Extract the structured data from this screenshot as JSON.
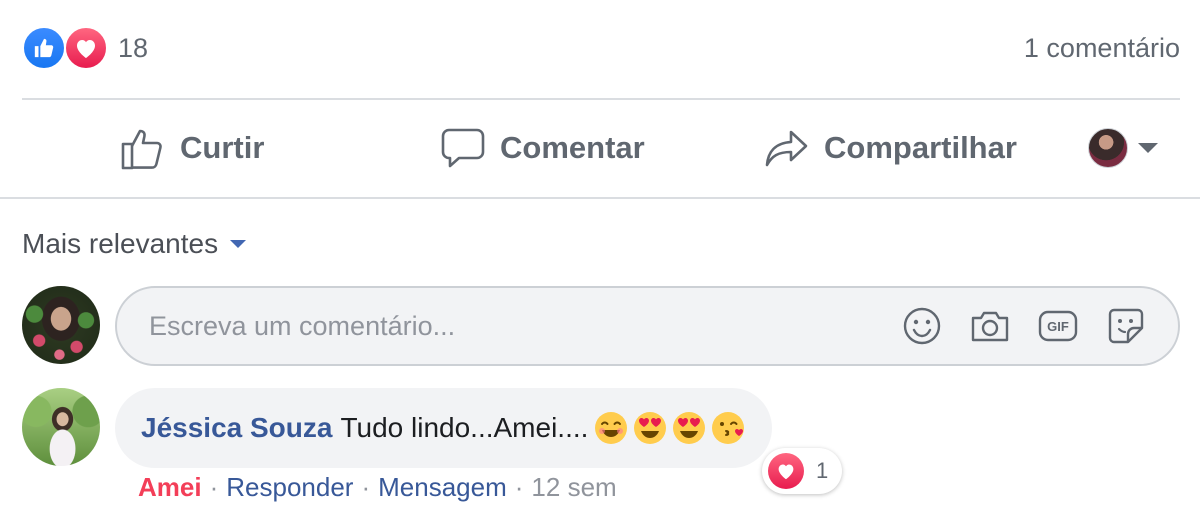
{
  "summary": {
    "reaction_icons": [
      "like-icon",
      "love-icon"
    ],
    "reaction_count": "18",
    "comment_count_label": "1 comentário",
    "colors": {
      "like": "#1877f2",
      "love": "#e81c4f"
    }
  },
  "actions": {
    "like_label": "Curtir",
    "comment_label": "Comentar",
    "share_label": "Compartilhar"
  },
  "sort": {
    "label": "Mais relevantes"
  },
  "composer": {
    "placeholder": "Escreva um comentário...",
    "icons": [
      "emoji-icon",
      "camera-icon",
      "gif-icon",
      "sticker-icon"
    ]
  },
  "comment": {
    "author": "Jéssica Souza",
    "text": "Tudo lindo...Amei....",
    "emojis": [
      "smiling-face-emoji",
      "heart-eyes-emoji",
      "heart-eyes-emoji",
      "kissing-face-emoji"
    ],
    "reaction": {
      "icon": "love-icon",
      "count": "1"
    },
    "reaction_label": "Amei",
    "reply_label": "Responder",
    "message_label": "Mensagem",
    "time": "12 sem",
    "colors": {
      "author": "#385898",
      "love": "#f33e58"
    }
  }
}
